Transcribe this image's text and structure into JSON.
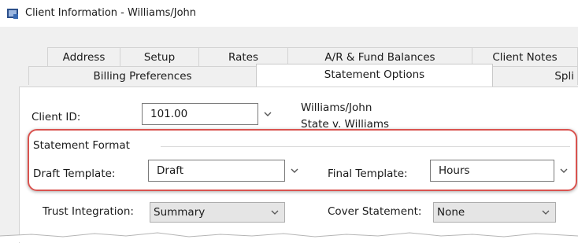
{
  "window": {
    "title": "Client Information - Williams/John"
  },
  "tabs_row1": [
    {
      "label": "Address"
    },
    {
      "label": "Setup"
    },
    {
      "label": "Rates"
    },
    {
      "label": "A/R & Fund Balances"
    },
    {
      "label": "Client Notes"
    }
  ],
  "tabs_row2": [
    {
      "label": "Billing Preferences"
    },
    {
      "label": "Statement Options"
    },
    {
      "label": "Spli"
    }
  ],
  "client": {
    "id_label": "Client ID:",
    "id_value": "101.00",
    "name": "Williams/John",
    "matter": "State v. Williams"
  },
  "statement_format": {
    "group_label": "Statement Format",
    "draft_label": "Draft Template:",
    "draft_value": "Draft",
    "final_label": "Final Template:",
    "final_value": "Hours"
  },
  "trust": {
    "label": "Trust Integration:",
    "value": "Summary"
  },
  "cover": {
    "label": "Cover Statement:",
    "value": "None"
  },
  "colors": {
    "highlight": "#d9534f",
    "tab_active": "#ffffff",
    "background": "#f0f0f0"
  }
}
